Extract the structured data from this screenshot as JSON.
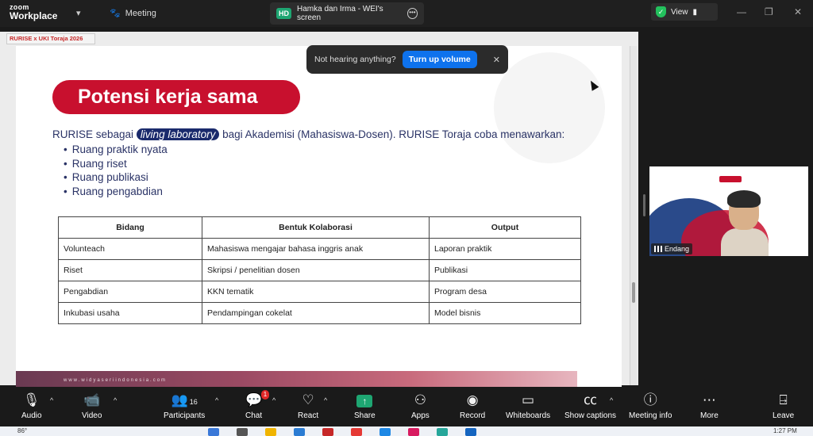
{
  "app": {
    "brand_top": "zoom",
    "brand_bottom": "Workplace",
    "meeting_label": "Meeting"
  },
  "share_tab": {
    "initials": "HD",
    "title": "Hamka dan Irma - WEI's screen"
  },
  "view_label": "View",
  "window_title": "RURISE x UKI Toraja 2026",
  "notice": {
    "text": "Not hearing anything?",
    "button": "Turn up volume"
  },
  "slide": {
    "title": "Potensi kerja sama",
    "intro_before": "RURISE sebagai ",
    "intro_highlight": "living laboratory",
    "intro_after": " bagi Akademisi (Mahasiswa-Dosen). RURISE Toraja coba menawarkan:",
    "bullets": [
      "Ruang praktik nyata",
      "Ruang riset",
      "Ruang publikasi",
      "Ruang pengabdian"
    ],
    "table": {
      "headers": [
        "Bidang",
        "Bentuk Kolaborasi",
        "Output"
      ],
      "rows": [
        [
          "Volunteach",
          "Mahasiswa mengajar bahasa inggris anak",
          "Laporan praktik"
        ],
        [
          "Riset",
          "Skripsi / penelitian dosen",
          "Publikasi"
        ],
        [
          "Pengabdian",
          "KKN tematik",
          "Program desa"
        ],
        [
          "Inkubasi usaha",
          "Pendampingan cokelat",
          "Model bisnis"
        ]
      ]
    },
    "footer_text": "www.widyaseriindonesia.com"
  },
  "participant_thumb": {
    "name": "Endang"
  },
  "toolbar": {
    "audio": "Audio",
    "video": "Video",
    "participants": "Participants",
    "participants_count": "16",
    "chat": "Chat",
    "chat_badge": "1",
    "react": "React",
    "share": "Share",
    "apps": "Apps",
    "record": "Record",
    "whiteboards": "Whiteboards",
    "captions": "Show captions",
    "info": "Meeting info",
    "more": "More",
    "leave": "Leave"
  },
  "taskbar": {
    "temp": "86°",
    "time": "1:27 PM"
  },
  "colors": {
    "accent": "#0e72ed",
    "title_red": "#c8102e",
    "share_green": "#1ea672",
    "leave_red": "#e02828"
  }
}
